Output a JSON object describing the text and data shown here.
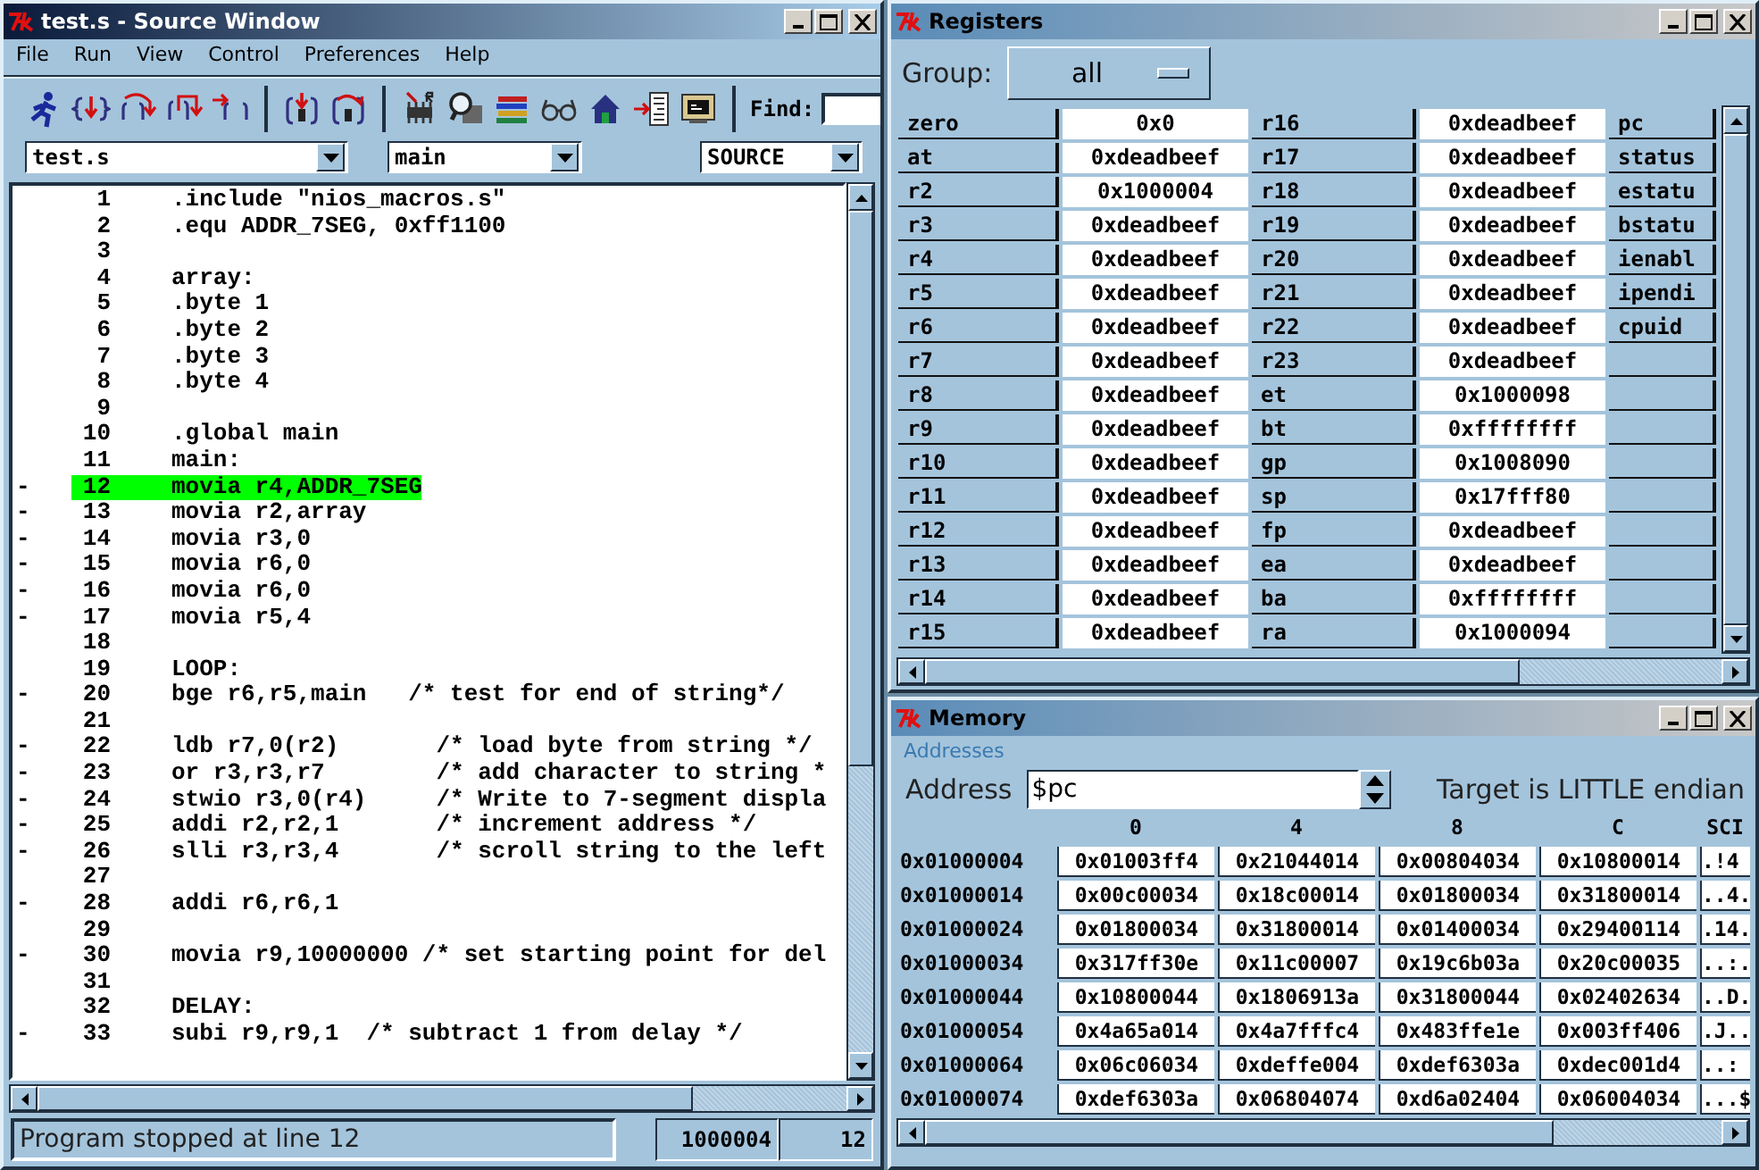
{
  "source_window": {
    "title": "test.s - Source Window",
    "menu": [
      "File",
      "Run",
      "View",
      "Control",
      "Preferences",
      "Help"
    ],
    "find_label": "Find:",
    "file_combo": "test.s",
    "function_combo": "main",
    "mode_combo": "SOURCE",
    "lines": [
      {
        "number": "1",
        "code": ".include \"nios_macros.s\"",
        "current": false
      },
      {
        "number": "2",
        "code": ".equ ADDR_7SEG, 0xff1100",
        "current": false
      },
      {
        "number": "3",
        "current": false
      },
      {
        "number": "4",
        "code": "array:",
        "current": false
      },
      {
        "number": "5",
        "code": ".byte 1",
        "current": false
      },
      {
        "number": "6",
        "code": ".byte 2",
        "current": false
      },
      {
        "number": "7",
        "code": ".byte 3",
        "current": false
      },
      {
        "number": "8",
        "code": ".byte 4",
        "current": false
      },
      {
        "number": "9",
        "current": false
      },
      {
        "number": "10",
        "code": ".global main",
        "current": false
      },
      {
        "number": "11",
        "code": "main:",
        "current": false
      },
      {
        "marker": "-",
        "number": "12",
        "code": "movia r4,ADDR_7SEG",
        "current": true
      },
      {
        "marker": "-",
        "number": "13",
        "code": "movia r2,array",
        "current": false
      },
      {
        "marker": "-",
        "number": "14",
        "code": "movia r3,0",
        "current": false
      },
      {
        "marker": "-",
        "number": "15",
        "code": "movia r6,0",
        "current": false
      },
      {
        "marker": "-",
        "number": "16",
        "code": "movia r6,0",
        "current": false
      },
      {
        "marker": "-",
        "number": "17",
        "code": "movia r5,4",
        "current": false
      },
      {
        "number": "18",
        "current": false
      },
      {
        "number": "19",
        "code": "LOOP:",
        "current": false
      },
      {
        "marker": "-",
        "number": "20",
        "code": "bge r6,r5,main   /* test for end of string*/",
        "current": false
      },
      {
        "number": "21",
        "current": false
      },
      {
        "marker": "-",
        "number": "22",
        "code": "ldb r7,0(r2)       /* load byte from string */",
        "current": false
      },
      {
        "marker": "-",
        "number": "23",
        "code": "or r3,r3,r7        /* add character to string *",
        "current": false
      },
      {
        "marker": "-",
        "number": "24",
        "code": "stwio r3,0(r4)     /* Write to 7-segment displa",
        "current": false
      },
      {
        "marker": "-",
        "number": "25",
        "code": "addi r2,r2,1       /* increment address */",
        "current": false
      },
      {
        "marker": "-",
        "number": "26",
        "code": "slli r3,r3,4       /* scroll string to the left",
        "current": false
      },
      {
        "number": "27",
        "current": false
      },
      {
        "marker": "-",
        "number": "28",
        "code": "addi r6,r6,1",
        "current": false
      },
      {
        "number": "29",
        "current": false
      },
      {
        "marker": "-",
        "number": "30",
        "code": "movia r9,10000000 /* set starting point for del",
        "current": false
      },
      {
        "number": "31",
        "current": false
      },
      {
        "number": "32",
        "code": "DELAY:",
        "current": false
      },
      {
        "marker": "-",
        "number": "33",
        "code": "subi r9,r9,1  /* subtract 1 from delay */",
        "current": false
      }
    ],
    "status": "Program stopped at line 12",
    "address": "1000004",
    "line": "12"
  },
  "registers_window": {
    "title": "Registers",
    "group_label": "Group:",
    "group": "all",
    "rows": [
      {
        "cells": [
          {
            "name": "zero",
            "value": "0x0"
          },
          {
            "name": "r16",
            "value": "0xdeadbeef"
          },
          {
            "name": "pc"
          }
        ]
      },
      {
        "cells": [
          {
            "name": "at",
            "value": "0xdeadbeef"
          },
          {
            "name": "r17",
            "value": "0xdeadbeef"
          },
          {
            "name": "status"
          }
        ]
      },
      {
        "cells": [
          {
            "name": "r2",
            "value": "0x1000004"
          },
          {
            "name": "r18",
            "value": "0xdeadbeef"
          },
          {
            "name": "estatu"
          }
        ]
      },
      {
        "cells": [
          {
            "name": "r3",
            "value": "0xdeadbeef"
          },
          {
            "name": "r19",
            "value": "0xdeadbeef"
          },
          {
            "name": "bstatu"
          }
        ]
      },
      {
        "cells": [
          {
            "name": "r4",
            "value": "0xdeadbeef"
          },
          {
            "name": "r20",
            "value": "0xdeadbeef"
          },
          {
            "name": "ienabl"
          }
        ]
      },
      {
        "cells": [
          {
            "name": "r5",
            "value": "0xdeadbeef"
          },
          {
            "name": "r21",
            "value": "0xdeadbeef"
          },
          {
            "name": "ipendi"
          }
        ]
      },
      {
        "cells": [
          {
            "name": "r6",
            "value": "0xdeadbeef"
          },
          {
            "name": "r22",
            "value": "0xdeadbeef"
          },
          {
            "name": "cpuid"
          }
        ]
      },
      {
        "cells": [
          {
            "name": "r7",
            "value": "0xdeadbeef"
          },
          {
            "name": "r23",
            "value": "0xdeadbeef"
          }
        ]
      },
      {
        "cells": [
          {
            "name": "r8",
            "value": "0xdeadbeef"
          },
          {
            "name": "et",
            "value": "0x1000098"
          }
        ]
      },
      {
        "cells": [
          {
            "name": "r9",
            "value": "0xdeadbeef"
          },
          {
            "name": "bt",
            "value": "0xffffffff"
          }
        ]
      },
      {
        "cells": [
          {
            "name": "r10",
            "value": "0xdeadbeef"
          },
          {
            "name": "gp",
            "value": "0x1008090"
          }
        ]
      },
      {
        "cells": [
          {
            "name": "r11",
            "value": "0xdeadbeef"
          },
          {
            "name": "sp",
            "value": "0x17fff80"
          }
        ]
      },
      {
        "cells": [
          {
            "name": "r12",
            "value": "0xdeadbeef"
          },
          {
            "name": "fp",
            "value": "0xdeadbeef"
          }
        ]
      },
      {
        "cells": [
          {
            "name": "r13",
            "value": "0xdeadbeef"
          },
          {
            "name": "ea",
            "value": "0xdeadbeef"
          }
        ]
      },
      {
        "cells": [
          {
            "name": "r14",
            "value": "0xdeadbeef"
          },
          {
            "name": "ba",
            "value": "0xffffffff"
          }
        ]
      },
      {
        "cells": [
          {
            "name": "r15",
            "value": "0xdeadbeef"
          },
          {
            "name": "ra",
            "value": "0x1000094"
          }
        ]
      }
    ]
  },
  "memory_window": {
    "title": "Memory",
    "menu": "Addresses",
    "address_label": "Address",
    "address": "$pc",
    "endian": "Target is LITTLE endian",
    "columns": [
      "0",
      "4",
      "8",
      "C",
      "SCI"
    ],
    "rows": [
      {
        "address": "0x01000004",
        "words": [
          "0x01003ff4",
          "0x21044014",
          "0x00804034",
          "0x10800014"
        ],
        "ascii": ".!4"
      },
      {
        "address": "0x01000014",
        "words": [
          "0x00c00034",
          "0x18c00014",
          "0x01800034",
          "0x31800014"
        ],
        "ascii": "..4."
      },
      {
        "address": "0x01000024",
        "words": [
          "0x01800034",
          "0x31800014",
          "0x01400034",
          "0x29400114"
        ],
        "ascii": ".14."
      },
      {
        "address": "0x01000034",
        "words": [
          "0x317ff30e",
          "0x11c00007",
          "0x19c6b03a",
          "0x20c00035"
        ],
        "ascii": "..:."
      },
      {
        "address": "0x01000044",
        "words": [
          "0x10800044",
          "0x1806913a",
          "0x31800044",
          "0x02402634"
        ],
        "ascii": "..D."
      },
      {
        "address": "0x01000054",
        "words": [
          "0x4a65a014",
          "0x4a7fffc4",
          "0x483ffe1e",
          "0x003ff406"
        ],
        "ascii": ".J.."
      },
      {
        "address": "0x01000064",
        "words": [
          "0x06c06034",
          "0xdeffe004",
          "0xdef6303a",
          "0xdec001d4"
        ],
        "ascii": "..:"
      },
      {
        "address": "0x01000074",
        "words": [
          "0xdef6303a",
          "0x06804074",
          "0xd6a02404",
          "0x06004034"
        ],
        "ascii": "...$"
      }
    ]
  }
}
